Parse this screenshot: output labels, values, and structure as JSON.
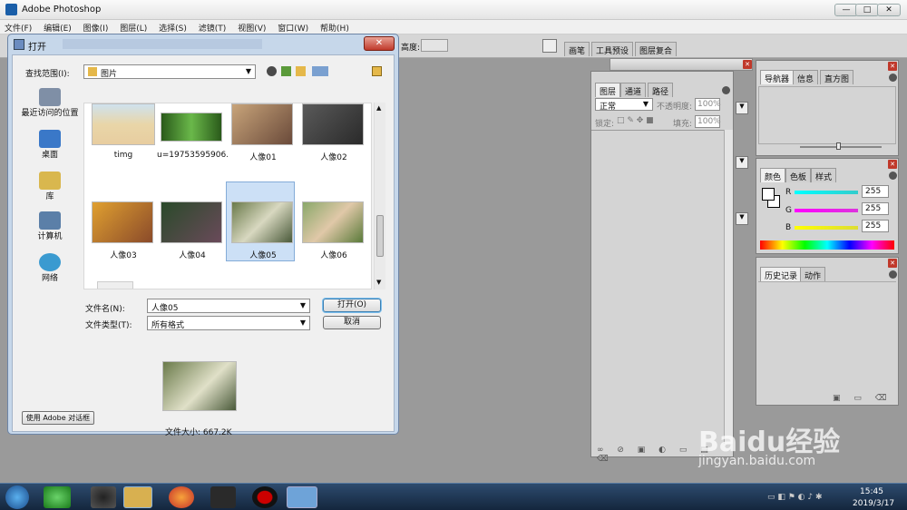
{
  "app": {
    "title": "Adobe Photoshop",
    "window_buttons": [
      "—",
      "□",
      "✕"
    ]
  },
  "menu": [
    "文件(F)",
    "编辑(E)",
    "图像(I)",
    "图层(L)",
    "选择(S)",
    "滤镜(T)",
    "视图(V)",
    "窗口(W)",
    "帮助(H)"
  ],
  "options_bar": {
    "height_label": "高度:",
    "tabs": [
      "画笔",
      "工具预设",
      "图层复合"
    ]
  },
  "dialog": {
    "title": "打开",
    "lookin_label": "查找范围(I):",
    "lookin_value": "图片",
    "places": [
      "最近访问的位置",
      "桌面",
      "库",
      "计算机",
      "网络"
    ],
    "files": [
      {
        "name": "timg"
      },
      {
        "name": "u=19753595906..."
      },
      {
        "name": "人像01"
      },
      {
        "name": "人像02"
      },
      {
        "name": "人像03"
      },
      {
        "name": "人像04"
      },
      {
        "name": "人像05",
        "selected": true
      },
      {
        "name": "人像06"
      }
    ],
    "filename_label": "文件名(N):",
    "filename_value": "人像05",
    "filetype_label": "文件类型(T):",
    "filetype_value": "所有格式",
    "open_button": "打开(O)",
    "cancel_button": "取消",
    "filesize": "文件大小: 667.2K",
    "adobe_dialog_button": "使用 Adobe 对话框"
  },
  "layers_panel": {
    "tabs": [
      "图层",
      "通道",
      "路径"
    ],
    "blend_mode": "正常",
    "opacity_label": "不透明度:",
    "opacity_value": "100%",
    "lock_label": "锁定:",
    "fill_label": "填充:",
    "fill_value": "100%"
  },
  "navigator_panel": {
    "tabs": [
      "导航器",
      "信息",
      "直方图"
    ]
  },
  "color_panel": {
    "tabs": [
      "颜色",
      "色板",
      "样式"
    ],
    "channels": [
      {
        "name": "R",
        "value": "255",
        "color": "#3cc"
      },
      {
        "name": "G",
        "value": "255",
        "color": "#d3d"
      },
      {
        "name": "B",
        "value": "255",
        "color": "#dd3"
      }
    ]
  },
  "history_panel": {
    "tabs": [
      "历史记录",
      "动作"
    ]
  },
  "taskbar": {
    "time": "15:45",
    "date": "2019/3/17"
  },
  "watermark": {
    "brand": "Baidu经验",
    "url": "jingyan.baidu.com"
  }
}
